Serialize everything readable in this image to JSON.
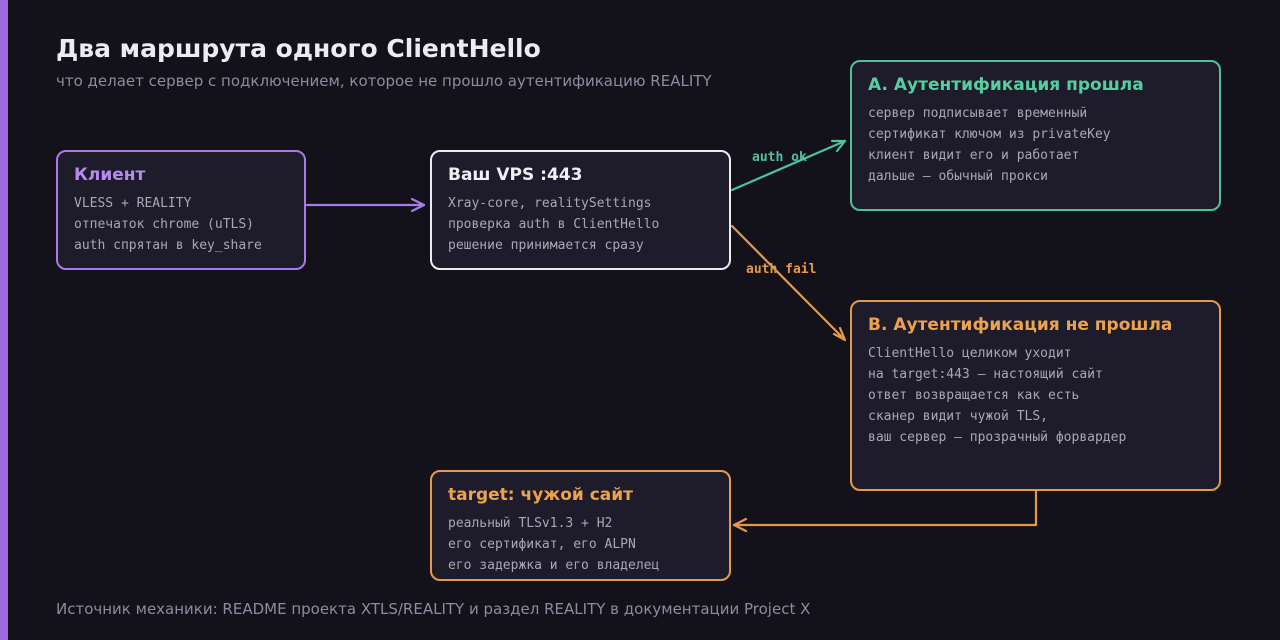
{
  "header": {
    "title": "Два маршрута одного ClientHello",
    "subtitle": "что делает сервер с подключением, которое не прошло аутентификацию REALITY"
  },
  "colors": {
    "background": "#13121a",
    "accent_purple": "#a97ae8",
    "accent_green": "#4fc29a",
    "accent_orange": "#e4994b",
    "node_white": "#eceaf2"
  },
  "nodes": {
    "client": {
      "title": "Клиент",
      "lines": [
        "VLESS + REALITY",
        "отпечаток chrome (uTLS)",
        "auth спрятан в key_share"
      ]
    },
    "vps": {
      "title": "Ваш VPS :443",
      "lines": [
        "Xray-core, realitySettings",
        "проверка auth в ClientHello",
        "решение принимается сразу"
      ]
    },
    "auth_ok": {
      "title": "A. Аутентификация прошла",
      "lines": [
        "сервер подписывает временный",
        "сертификат ключом из privateKey",
        "клиент видит его и работает",
        "дальше — обычный прокси"
      ]
    },
    "auth_fail": {
      "title": "B. Аутентификация не прошла",
      "lines": [
        "ClientHello целиком уходит",
        "на target:443 — настоящий сайт",
        "ответ возвращается как есть",
        "сканер видит чужой TLS,",
        "ваш сервер — прозрачный форвардер"
      ]
    },
    "target": {
      "title": "target: чужой сайт",
      "lines": [
        "реальный TLSv1.3 + H2",
        "его сертификат, его ALPN",
        "его задержка и его владелец"
      ]
    }
  },
  "edges": {
    "auth_ok_label": "auth ok",
    "auth_fail_label": "auth fail"
  },
  "footer": {
    "text": "Источник механики: README проекта XTLS/REALITY и раздел REALITY в документации Project X"
  }
}
